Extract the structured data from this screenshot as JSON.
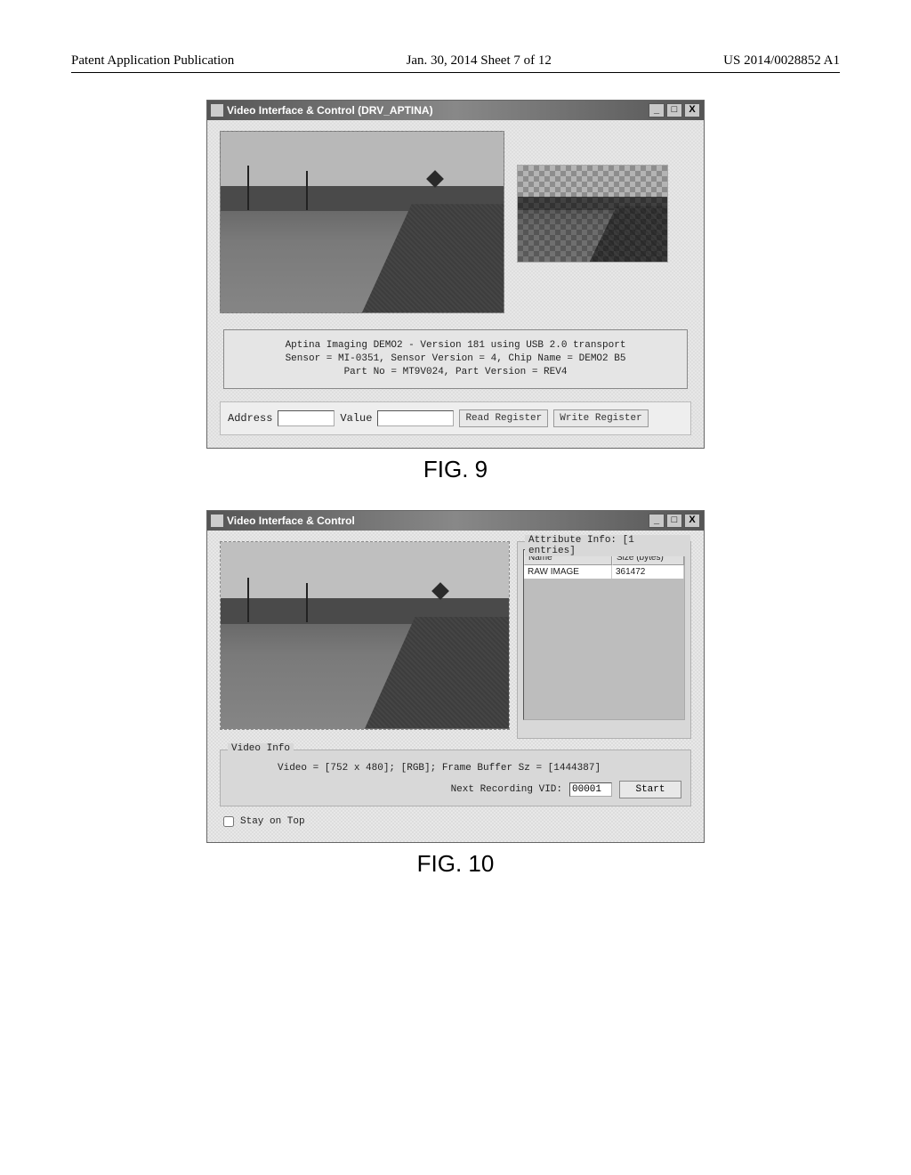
{
  "header": {
    "left": "Patent Application Publication",
    "center": "Jan. 30, 2014  Sheet 7 of 12",
    "right": "US 2014/0028852 A1"
  },
  "fig9": {
    "titlebar": "Video Interface & Control (DRV_APTINA)",
    "win_min": "_",
    "win_max": "□",
    "win_close": "X",
    "info_text": "Aptina Imaging DEMO2 - Version 181 using  USB 2.0 transport\nSensor = MI-0351, Sensor Version = 4, Chip Name = DEMO2 B5\nPart No = MT9V024, Part Version = REV4",
    "address_label": "Address",
    "address_value": "",
    "value_label": "Value",
    "value_value": "",
    "read_btn": "Read Register",
    "write_btn": "Write Register",
    "caption": "FIG. 9"
  },
  "fig10": {
    "titlebar": "Video Interface & Control",
    "win_min": "_",
    "win_max": "□",
    "win_close": "X",
    "attr_legend": "Attribute Info: [1 entries]",
    "col_name": "Name",
    "col_size": "Size (bytes)",
    "row_name": "RAW IMAGE",
    "row_size": "361472",
    "video_info_legend": "Video Info",
    "video_info_line": "Video = [752 x 480];  [RGB];  Frame Buffer Sz = [1444387]",
    "next_rec_label": "Next Recording VID:",
    "next_rec_value": "00001",
    "start_btn": "Start",
    "stay_on_top": "Stay on Top",
    "caption": "FIG. 10"
  }
}
